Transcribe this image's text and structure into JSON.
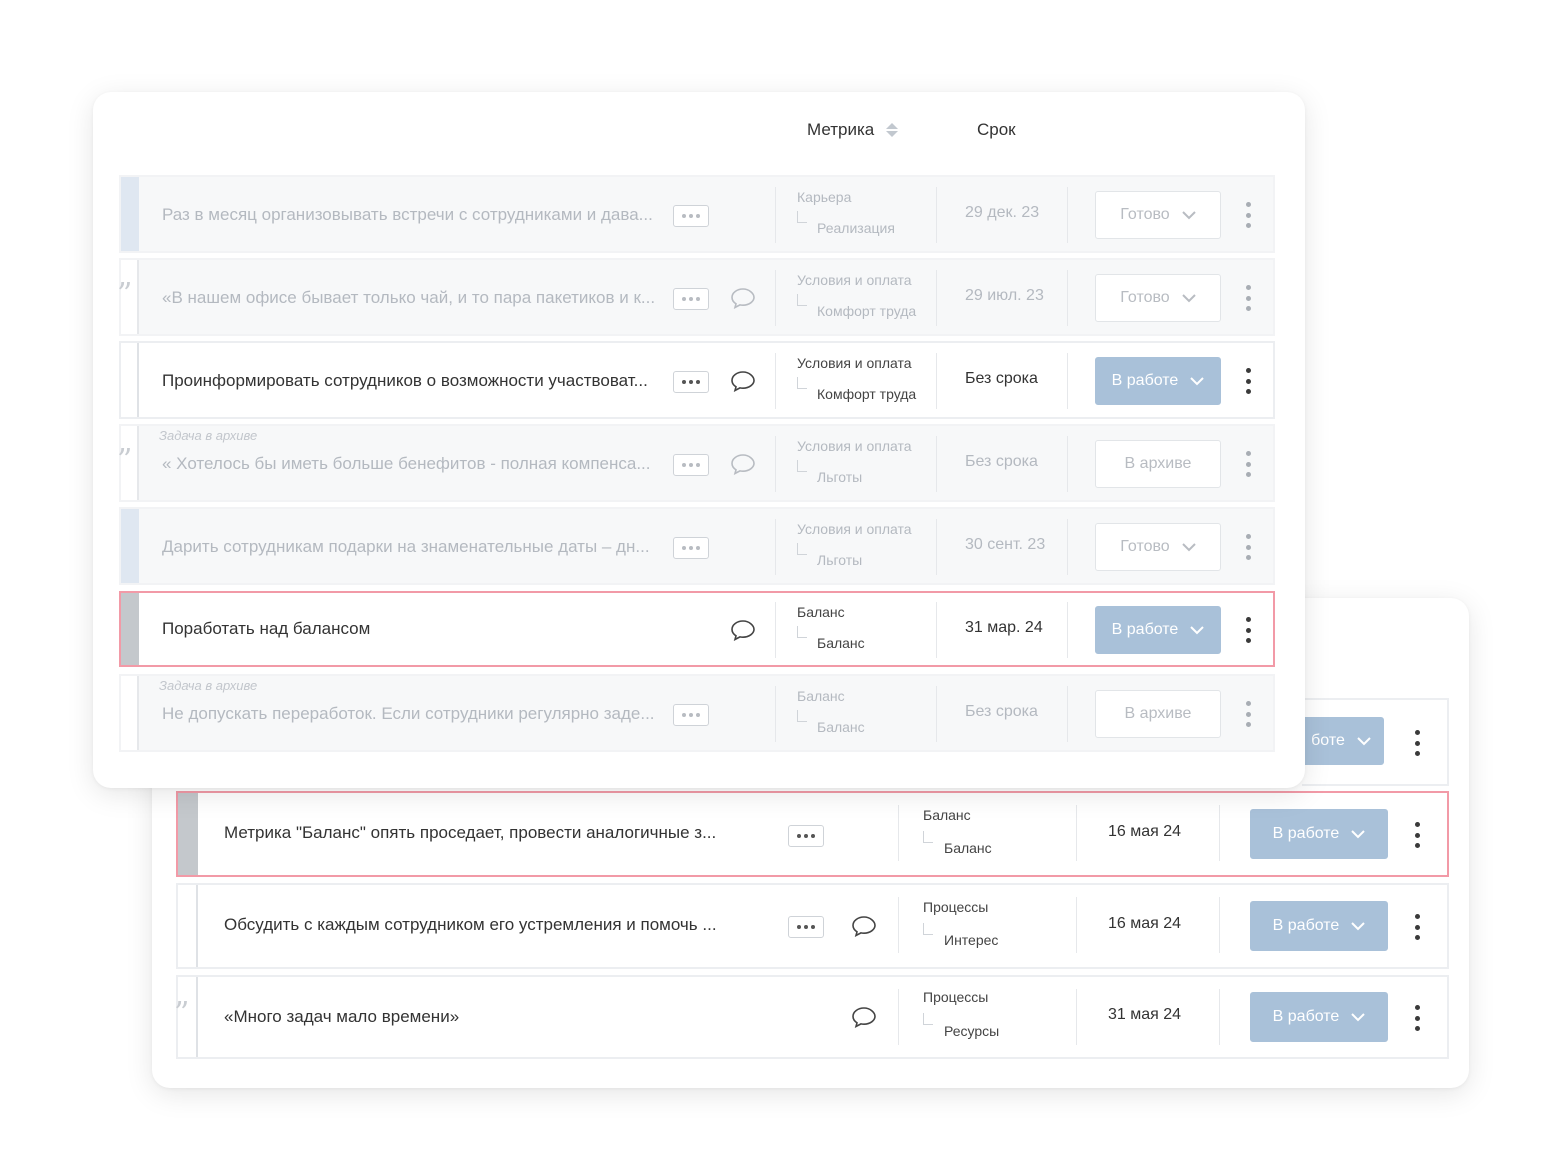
{
  "header": {
    "metric_label": "Метрика",
    "deadline_label": "Срок"
  },
  "front_rows": [
    {
      "text": "Раз в месяц организовывать встречи с сотрудниками и дава...",
      "metric": "Карьера",
      "submetric": "Реализация",
      "deadline": "29 дек. 23",
      "status": "Готово"
    },
    {
      "text": "«В нашем офисе бывает только чай, и то пара пакетиков и к...",
      "metric": "Условия и оплата",
      "submetric": "Комфорт труда",
      "deadline": "29 июл. 23",
      "status": "Готово"
    },
    {
      "text": "Проинформировать сотрудников о возможности участвоват...",
      "metric": "Условия и оплата",
      "submetric": "Комфорт труда",
      "deadline": "Без срока",
      "status": "В работе"
    },
    {
      "archive_note": "Задача в архиве",
      "text": "« Хотелось бы иметь больше бенефитов - полная компенса...",
      "metric": "Условия и оплата",
      "submetric": "Льготы",
      "deadline": "Без срока",
      "status": "В архиве"
    },
    {
      "text": "Дарить сотрудникам подарки на знаменательные даты – дн...",
      "metric": "Условия и оплата",
      "submetric": "Льготы",
      "deadline": "30 сент. 23",
      "status": "Готово"
    },
    {
      "text": "Поработать над балансом",
      "metric": "Баланс",
      "submetric": "Баланс",
      "deadline": "31 мар. 24",
      "status": "В работе"
    },
    {
      "archive_note": "Задача в архиве",
      "text": "Не допускать переработок. Если сотрудники регулярно заде...",
      "metric": "Баланс",
      "submetric": "Баланс",
      "deadline": "Без срока",
      "status": "В архиве"
    }
  ],
  "back_partial_status": "боте",
  "back_rows": [
    {
      "text": "Метрика \"Баланс\" опять проседает, провести аналогичные з...",
      "metric": "Баланс",
      "submetric": "Баланс",
      "deadline": "16 мая 24",
      "status": "В работе"
    },
    {
      "text": "Обсудить с каждым сотрудником его устремления и помочь ...",
      "metric": "Процессы",
      "submetric": "Интерес",
      "deadline": "16 мая 24",
      "status": "В работе"
    },
    {
      "text": "«Много задач мало времени»",
      "metric": "Процессы",
      "submetric": "Ресурсы",
      "deadline": "31 мая 24",
      "status": "В работе"
    }
  ],
  "colors": {
    "accent_button": "#a9c1d9",
    "highlight_border": "#f29aa7",
    "stripe_blue": "#dfe7f1",
    "stripe_gray": "#c4c8cc"
  },
  "icons": [
    "sort-icon",
    "more-icon",
    "comment-icon",
    "quote-icon",
    "chevron-down-icon",
    "kebab-icon"
  ]
}
